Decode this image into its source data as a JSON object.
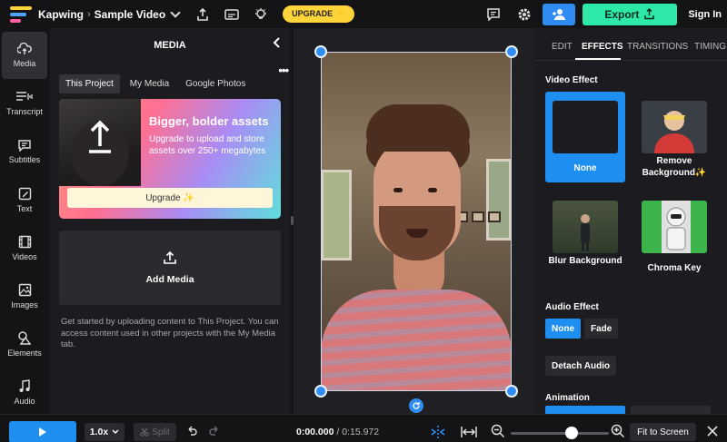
{
  "header": {
    "brand": "Kapwing",
    "separator": "›",
    "project_title": "Sample Video",
    "upgrade_label": "UPGRADE ⚡",
    "export_label": "Export",
    "signin_label": "Sign In"
  },
  "rail": {
    "items": [
      {
        "label": "Media",
        "icon": "upload-cloud-icon"
      },
      {
        "label": "Transcript",
        "icon": "transcript-icon"
      },
      {
        "label": "Subtitles",
        "icon": "subtitles-icon"
      },
      {
        "label": "Text",
        "icon": "text-edit-icon"
      },
      {
        "label": "Videos",
        "icon": "film-icon"
      },
      {
        "label": "Images",
        "icon": "image-icon"
      },
      {
        "label": "Elements",
        "icon": "shapes-icon"
      },
      {
        "label": "Audio",
        "icon": "music-note-icon"
      }
    ]
  },
  "media": {
    "title": "MEDIA",
    "tabs": [
      "This Project",
      "My Media",
      "Google Photos"
    ],
    "promo": {
      "title": "Bigger, bolder assets",
      "body": "Upgrade to upload and store assets over 250+ megabytes",
      "button": "Upgrade ✨"
    },
    "add_media": "Add Media",
    "help": "Get started by uploading content to This Project. You can access content used in other projects with the My Media tab."
  },
  "right": {
    "tabs": [
      "EDIT",
      "EFFECTS",
      "TRANSITIONS",
      "TIMING"
    ],
    "video_effect_label": "Video Effect",
    "effects": [
      {
        "label": "None"
      },
      {
        "label": "Remove Background✨"
      },
      {
        "label": "Blur Background"
      },
      {
        "label": "Chroma Key"
      }
    ],
    "audio_effect_label": "Audio Effect",
    "audio_options": [
      "None",
      "Fade"
    ],
    "detach_audio": "Detach Audio",
    "animation_label": "Animation"
  },
  "bottom": {
    "speed": "1.0x",
    "split": "Split",
    "current_time": "0:00.000",
    "time_sep": " / ",
    "total_time": "0:15.972",
    "fit_to_screen": "Fit to Screen"
  },
  "colors": {
    "accent_blue": "#1f8ef1",
    "export_green": "#2ee8a8",
    "upgrade_yellow": "#ffd43b"
  }
}
